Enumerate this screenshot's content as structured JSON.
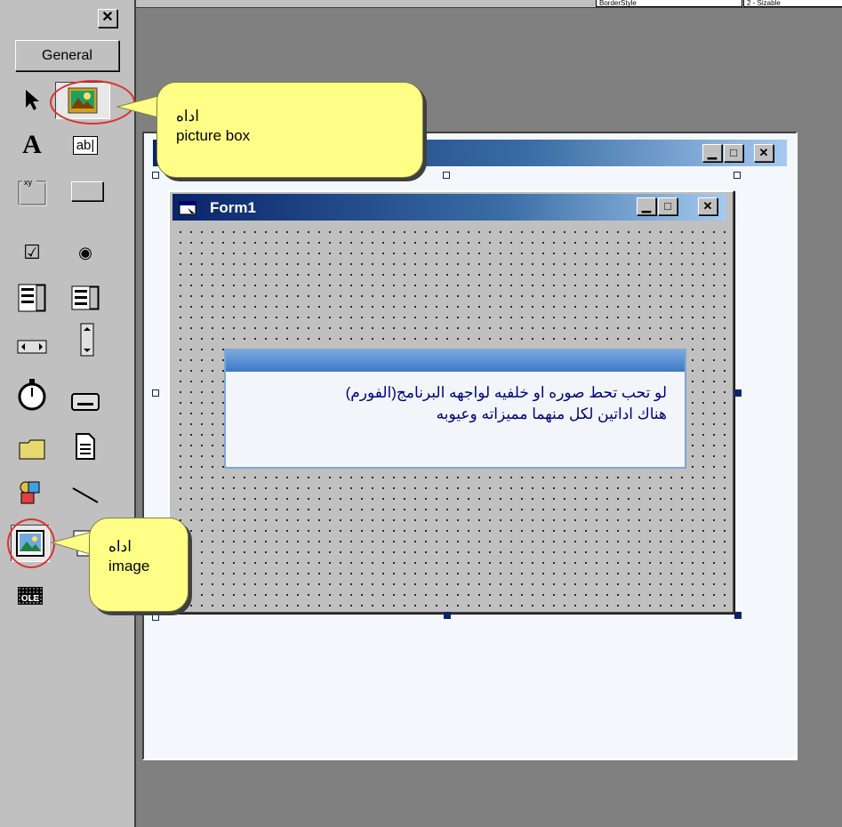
{
  "properties_fragment": {
    "name_cell": "BorderStyle",
    "value_cell": "2 - Sizable"
  },
  "toolbox": {
    "close_glyph": "✕",
    "tab_label": "General",
    "tools": [
      {
        "name": "pointer"
      },
      {
        "name": "picturebox"
      },
      {
        "name": "label",
        "glyph": "A"
      },
      {
        "name": "textbox",
        "glyph": "ab|"
      },
      {
        "name": "frame",
        "glyph": "xy"
      },
      {
        "name": "commandbutton"
      },
      {
        "name": "checkbox",
        "glyph": "☑"
      },
      {
        "name": "optionbutton",
        "glyph": "◉"
      },
      {
        "name": "combobox"
      },
      {
        "name": "listbox"
      },
      {
        "name": "hscrollbar"
      },
      {
        "name": "vscrollbar"
      },
      {
        "name": "timer"
      },
      {
        "name": "drivelistbox"
      },
      {
        "name": "dirlistbox"
      },
      {
        "name": "filelistbox"
      },
      {
        "name": "shape"
      },
      {
        "name": "line"
      },
      {
        "name": "image"
      },
      {
        "name": "data"
      },
      {
        "name": "ole",
        "glyph": "OLE"
      }
    ]
  },
  "form1": {
    "title": "Form1"
  },
  "message_box": {
    "line1": "لو تحب تحط صوره او خلفيه لواجهه البرنامج(الفورم)",
    "line2": "هناك اداتين لكل منهما مميزاته وعيوبه"
  },
  "callouts": {
    "picture_box": {
      "line1": "اداه",
      "line2": "picture box"
    },
    "image": {
      "line1": "اداه",
      "line2": "image"
    }
  },
  "colors": {
    "titlebar_start": "#0a246a",
    "titlebar_end": "#a6caf0",
    "callout_fill": "#ffff88",
    "highlight_ring": "#e03030",
    "message_text": "#000080"
  }
}
